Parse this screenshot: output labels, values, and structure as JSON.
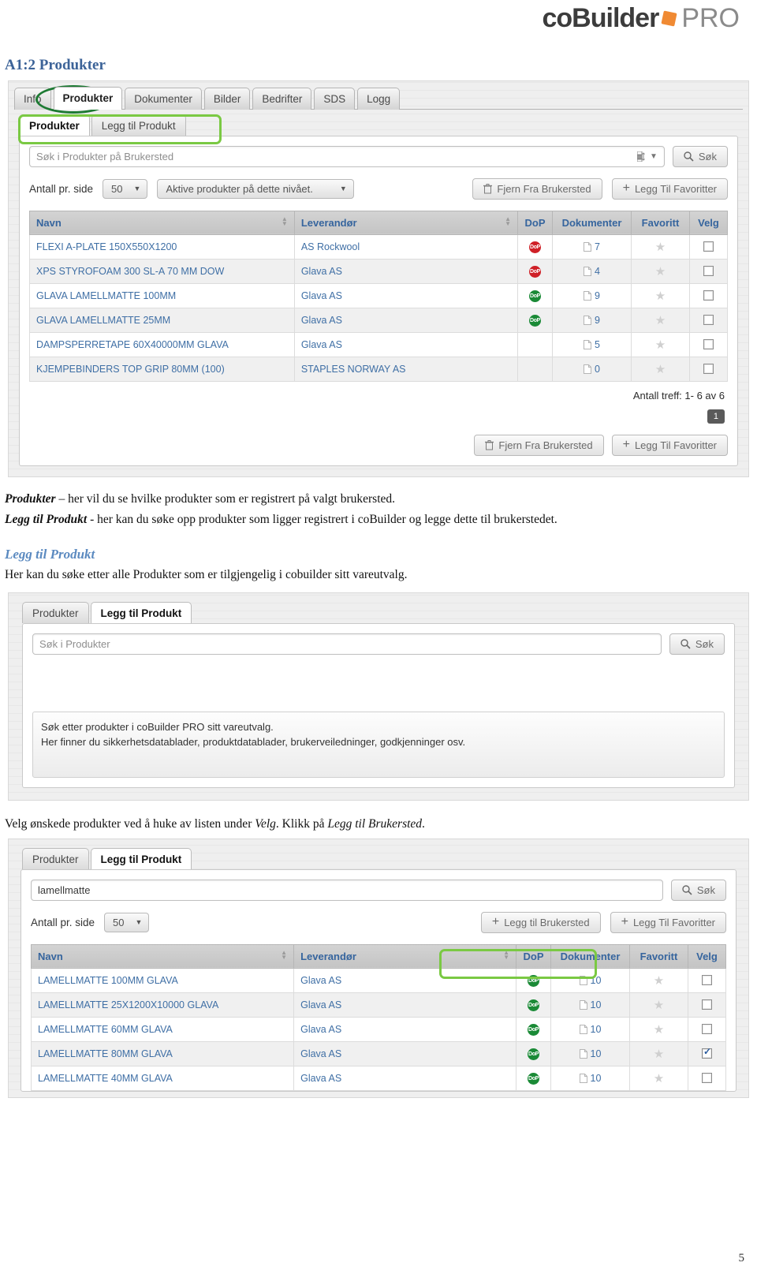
{
  "brand": {
    "name_main": "coBuilder",
    "name_sub": "PRO",
    "accent": "#f08a33"
  },
  "document": {
    "heading": "A1:2 Produkter",
    "paragraph1_em": "Produkter",
    "paragraph1_rest": " – her vil du se hvilke produkter som er registrert på valgt brukersted.",
    "paragraph2_em": "Legg til Produkt",
    "paragraph2_rest": " - her kan du søke opp produkter som ligger registrert i coBuilder og legge dette til brukerstedet.",
    "section_heading": "Legg til Produkt",
    "paragraph3": "Her kan du søke etter alle Produkter som er tilgjengelig i cobuilder sitt vareutvalg.",
    "paragraph4_a": "Velg ønskede produkter ved å huke av listen under ",
    "paragraph4_em1": "Velg",
    "paragraph4_b": ". Klikk på ",
    "paragraph4_em2": "Legg til Brukersted",
    "paragraph4_c": ".",
    "page_number": "5"
  },
  "screenshot1": {
    "tabs": [
      {
        "label": "Info",
        "active": false
      },
      {
        "label": "Produkter",
        "active": true
      },
      {
        "label": "Dokumenter",
        "active": false
      },
      {
        "label": "Bilder",
        "active": false
      },
      {
        "label": "Bedrifter",
        "active": false
      },
      {
        "label": "SDS",
        "active": false
      },
      {
        "label": "Logg",
        "active": false
      }
    ],
    "subtabs": [
      {
        "label": "Produkter",
        "active": true
      },
      {
        "label": "Legg til Produkt",
        "active": false
      }
    ],
    "search": {
      "placeholder": "Søk i Produkter på Brukersted",
      "button_label": "Søk"
    },
    "controls": {
      "per_page_label": "Antall pr. side",
      "per_page_value": "50",
      "filter_value": "Aktive produkter på dette nivået.",
      "remove_button": "Fjern Fra Brukersted",
      "favorite_button": "Legg Til Favoritter"
    },
    "table": {
      "columns": [
        "Navn",
        "Leverandør",
        "DoP",
        "Dokumenter",
        "Favoritt",
        "Velg"
      ],
      "rows": [
        {
          "navn": "FLEXI A-PLATE 150X550X1200",
          "leverandor": "AS Rockwool",
          "dop": "red",
          "dokumenter": "7",
          "favoritt": false,
          "velg": false
        },
        {
          "navn": "XPS STYROFOAM 300 SL-A 70 MM DOW",
          "leverandor": "Glava AS",
          "dop": "red",
          "dokumenter": "4",
          "favoritt": false,
          "velg": false
        },
        {
          "navn": "GLAVA LAMELLMATTE 100MM",
          "leverandor": "Glava AS",
          "dop": "green",
          "dokumenter": "9",
          "favoritt": false,
          "velg": false
        },
        {
          "navn": "GLAVA LAMELLMATTE 25MM",
          "leverandor": "Glava AS",
          "dop": "green",
          "dokumenter": "9",
          "favoritt": false,
          "velg": false
        },
        {
          "navn": "DAMPSPERRETAPE 60X40000MM GLAVA",
          "leverandor": "Glava AS",
          "dop": "none",
          "dokumenter": "5",
          "favoritt": false,
          "velg": false
        },
        {
          "navn": "KJEMPEBINDERS TOP GRIP 80MM (100)",
          "leverandor": "STAPLES NORWAY AS",
          "dop": "none",
          "dokumenter": "0",
          "favoritt": false,
          "velg": false
        }
      ]
    },
    "hits": "Antall treff: 1- 6 av 6",
    "page_button": "1",
    "footer": {
      "remove_button": "Fjern Fra Brukersted",
      "favorite_button": "Legg Til Favoritter"
    }
  },
  "screenshot2": {
    "subtabs": [
      {
        "label": "Produkter",
        "active": false
      },
      {
        "label": "Legg til Produkt",
        "active": true
      }
    ],
    "search": {
      "placeholder": "Søk i Produkter",
      "button_label": "Søk"
    },
    "message_line1": "Søk etter produkter i coBuilder PRO sitt vareutvalg.",
    "message_line2": "Her finner du sikkerhetsdatablader, produktdatablader, brukerveiledninger, godkjenninger osv."
  },
  "screenshot3": {
    "subtabs": [
      {
        "label": "Produkter",
        "active": false
      },
      {
        "label": "Legg til Produkt",
        "active": true
      }
    ],
    "search": {
      "value": "lamellmatte",
      "button_label": "Søk"
    },
    "controls": {
      "per_page_label": "Antall pr. side",
      "per_page_value": "50",
      "add_button": "Legg til Brukersted",
      "favorite_button": "Legg Til Favoritter"
    },
    "table": {
      "columns": [
        "Navn",
        "Leverandør",
        "DoP",
        "Dokumenter",
        "Favoritt",
        "Velg"
      ],
      "rows": [
        {
          "navn": "LAMELLMATTE 100MM GLAVA",
          "leverandor": "Glava AS",
          "dop": "green",
          "dokumenter": "10",
          "favoritt": false,
          "velg": false
        },
        {
          "navn": "LAMELLMATTE 25X1200X10000 GLAVA",
          "leverandor": "Glava AS",
          "dop": "green",
          "dokumenter": "10",
          "favoritt": false,
          "velg": false
        },
        {
          "navn": "LAMELLMATTE 60MM GLAVA",
          "leverandor": "Glava AS",
          "dop": "green",
          "dokumenter": "10",
          "favoritt": false,
          "velg": false
        },
        {
          "navn": "LAMELLMATTE 80MM GLAVA",
          "leverandor": "Glava AS",
          "dop": "green",
          "dokumenter": "10",
          "favoritt": false,
          "velg": true
        },
        {
          "navn": "LAMELLMATTE 40MM GLAVA",
          "leverandor": "Glava AS",
          "dop": "green",
          "dokumenter": "10",
          "favoritt": false,
          "velg": false
        }
      ]
    }
  },
  "icons": {
    "search": "search-icon",
    "trash": "trash-icon",
    "plus": "plus-icon",
    "caret": "chevron-down-icon",
    "document": "document-icon",
    "star": "star-icon",
    "dop": "dop-badge-icon"
  }
}
